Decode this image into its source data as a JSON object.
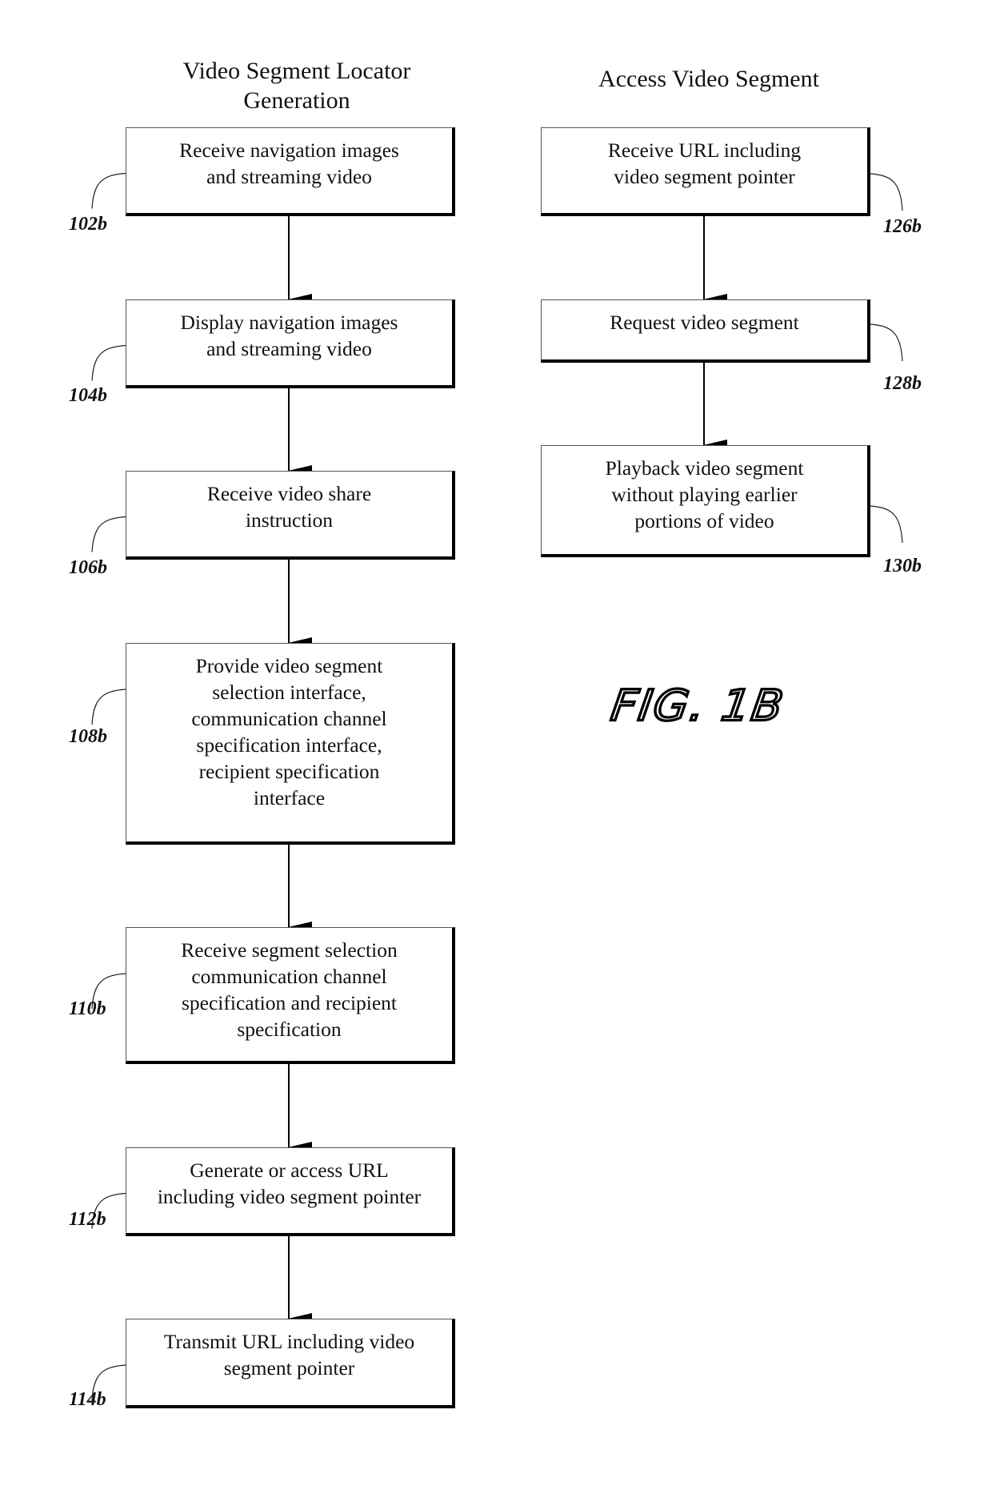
{
  "figure_label": "FIG. 1B",
  "columns": [
    {
      "id": "left",
      "title": "Video Segment Locator\nGeneration",
      "steps": [
        {
          "ref": "102b",
          "text": "Receive navigation images\nand streaming video"
        },
        {
          "ref": "104b",
          "text": "Display navigation images\nand streaming video"
        },
        {
          "ref": "106b",
          "text": "Receive video share\ninstruction"
        },
        {
          "ref": "108b",
          "text": "Provide video segment\nselection interface,\ncommunication channel\nspecification interface,\nrecipient specification\ninterface"
        },
        {
          "ref": "110b",
          "text": "Receive segment selection\ncommunication channel\nspecification and recipient\nspecification"
        },
        {
          "ref": "112b",
          "text": "Generate or access URL\nincluding video segment pointer"
        },
        {
          "ref": "114b",
          "text": "Transmit URL including video\nsegment pointer"
        }
      ]
    },
    {
      "id": "right",
      "title": "Access Video Segment",
      "steps": [
        {
          "ref": "126b",
          "text": "Receive URL including\nvideo segment pointer"
        },
        {
          "ref": "128b",
          "text": "Request video segment"
        },
        {
          "ref": "130b",
          "text": "Playback video segment\nwithout playing earlier\nportions of video"
        }
      ]
    }
  ],
  "edges": [
    {
      "from": "102b",
      "to": "104b"
    },
    {
      "from": "104b",
      "to": "106b"
    },
    {
      "from": "106b",
      "to": "108b"
    },
    {
      "from": "108b",
      "to": "110b"
    },
    {
      "from": "110b",
      "to": "112b"
    },
    {
      "from": "112b",
      "to": "114b"
    },
    {
      "from": "126b",
      "to": "128b"
    },
    {
      "from": "128b",
      "to": "130b"
    }
  ]
}
